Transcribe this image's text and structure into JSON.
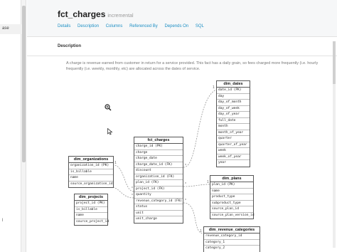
{
  "sidebar": {
    "selected_label": "ase",
    "hint_label": "l"
  },
  "header": {
    "title": "fct_charges",
    "materialization": "incremental",
    "tabs": [
      "Details",
      "Description",
      "Columns",
      "Referenced By",
      "Depends On",
      "SQL"
    ]
  },
  "description": {
    "heading": "Description",
    "line1": "A charge is revenue earned from customer in return for a service provided. This fact has a daily grain, so fees charged more frequently (i.e. hourly",
    "line2": "frequently (i.e. weekly, monthly, etc) are allocated across the dates of service."
  },
  "erd": {
    "dim_dates": {
      "name": "dim_dates",
      "columns": [
        "date_id (PK)",
        "day",
        "day_of_month",
        "day_of_week",
        "day_of_year",
        "full_date",
        "month",
        "month_of_year",
        "quarter",
        "quarter_of_year",
        "week",
        "week_of_year",
        "year"
      ]
    },
    "fct_charges": {
      "name": "fct_charges",
      "columns": [
        "charge_id (PK)",
        "charge",
        "charge_date",
        "charge_date_id (FK)",
        "discount",
        "organization_id (FK)",
        "plan_id (FK)",
        "project_id (FK)",
        "quantity",
        "revenue_category_id (FK)",
        "status",
        "unit",
        "unit_charge"
      ]
    },
    "dim_organizations": {
      "name": "dim_organizations",
      "columns": [
        "organization_id (PK)",
        "is_billable",
        "name",
        "source_organization_id"
      ]
    },
    "dim_projects": {
      "name": "dim_projects",
      "columns": [
        "project_id (PK)",
        "is_billable",
        "name",
        "source_project_id"
      ]
    },
    "dim_plans": {
      "name": "dim_plans",
      "columns": [
        "plan_id (PK)",
        "name",
        "product_type",
        "subproduct_type",
        "source_plan_id",
        "source_plan_version_id"
      ]
    },
    "dim_revenue_categories": {
      "name": "dim_revenue_categories",
      "columns": [
        "revenue_category_id",
        "category_1",
        "category_2"
      ]
    },
    "cardinality": {
      "many": "*",
      "one": "1"
    }
  },
  "colors": {
    "link": "#1d8fc4",
    "header_bg": "#f6f7f8",
    "edge": "#999999"
  }
}
